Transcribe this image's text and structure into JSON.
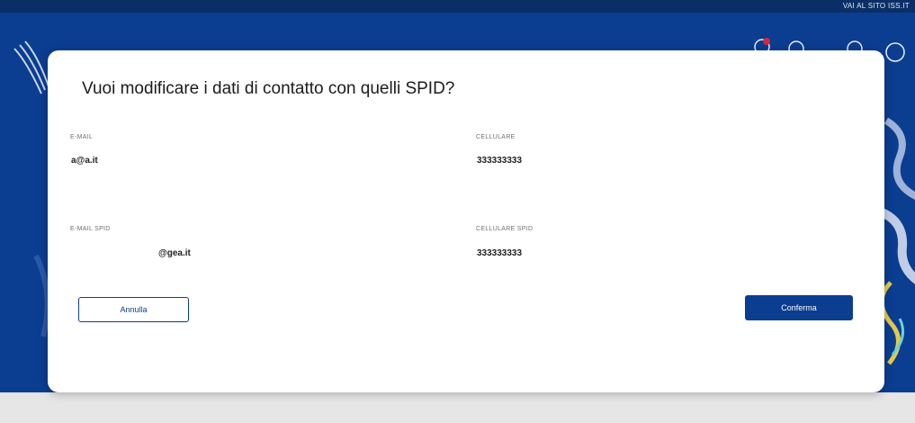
{
  "topbar": {
    "link_text": "VAI AL SITO ISS.IT"
  },
  "dialog": {
    "title": "Vuoi modificare i dati di contatto con quelli SPID?",
    "fields": {
      "email": {
        "label": "E-MAIL",
        "value": "a@a.it"
      },
      "phone": {
        "label": "CELLULARE",
        "value": "333333333"
      },
      "email_spid": {
        "label": "E-MAIL SPID",
        "value": "@gea.it"
      },
      "phone_spid": {
        "label": "CELLULARE SPID",
        "value": "333333333"
      }
    },
    "cancel_label": "Annulla",
    "confirm_label": "Conferma"
  },
  "colors": {
    "primary": "#0b3d91",
    "topbar": "#0a2f66",
    "background": "#e4e4e4"
  },
  "icons": [
    "notification-icon",
    "user-icon",
    "settings-icon",
    "logout-icon"
  ]
}
